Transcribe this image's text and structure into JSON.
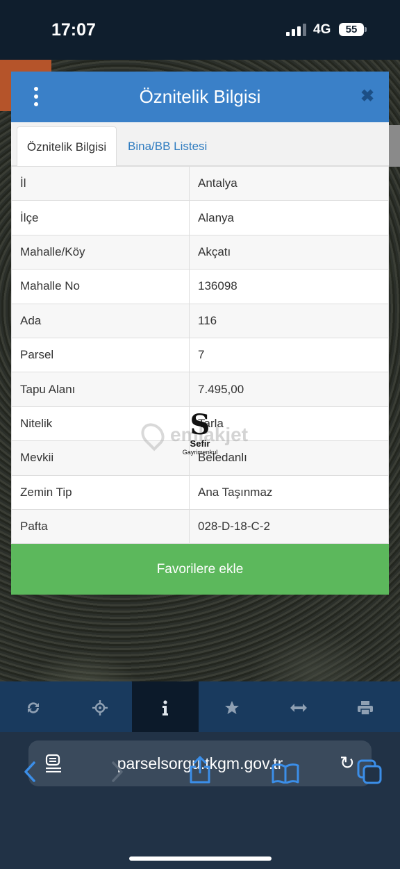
{
  "status_bar": {
    "time": "17:07",
    "network": "4G",
    "battery": "55"
  },
  "dialog": {
    "title": "Öznitelik Bilgisi",
    "tabs": [
      {
        "label": "Öznitelik Bilgisi",
        "active": true
      },
      {
        "label": "Bina/BB Listesi",
        "active": false
      }
    ],
    "rows": [
      {
        "key": "İl",
        "value": "Antalya"
      },
      {
        "key": "İlçe",
        "value": "Alanya"
      },
      {
        "key": "Mahalle/Köy",
        "value": "Akçatı"
      },
      {
        "key": "Mahalle No",
        "value": "136098"
      },
      {
        "key": "Ada",
        "value": "116"
      },
      {
        "key": "Parsel",
        "value": "7"
      },
      {
        "key": "Tapu Alanı",
        "value": "7.495,00"
      },
      {
        "key": "Nitelik",
        "value": "Tarla"
      },
      {
        "key": "Mevkii",
        "value": "Beledanlı"
      },
      {
        "key": "Zemin Tip",
        "value": "Ana Taşınmaz"
      },
      {
        "key": "Pafta",
        "value": "028-D-18-C-2"
      }
    ],
    "favorite_button": "Favorilere ekle"
  },
  "watermarks": {
    "emlakjet": "emlakjet",
    "sefir_letter": "S",
    "sefir_name": "Sefir",
    "sefir_sub": "Gayrimenkul"
  },
  "map_toolbar": {
    "tools": [
      {
        "icon": "refresh-icon",
        "active": false
      },
      {
        "icon": "locate-icon",
        "active": false
      },
      {
        "icon": "info-icon",
        "active": true
      },
      {
        "icon": "star-icon",
        "active": false
      },
      {
        "icon": "measure-icon",
        "active": false
      },
      {
        "icon": "print-icon",
        "active": false
      }
    ]
  },
  "browser": {
    "url": "parselsorgu.tkgm.gov.tr"
  },
  "colors": {
    "header_blue": "#3a80c8",
    "button_green": "#5cb85c",
    "toolbar_navy": "#193a5e",
    "browser_bar": "#213246"
  }
}
